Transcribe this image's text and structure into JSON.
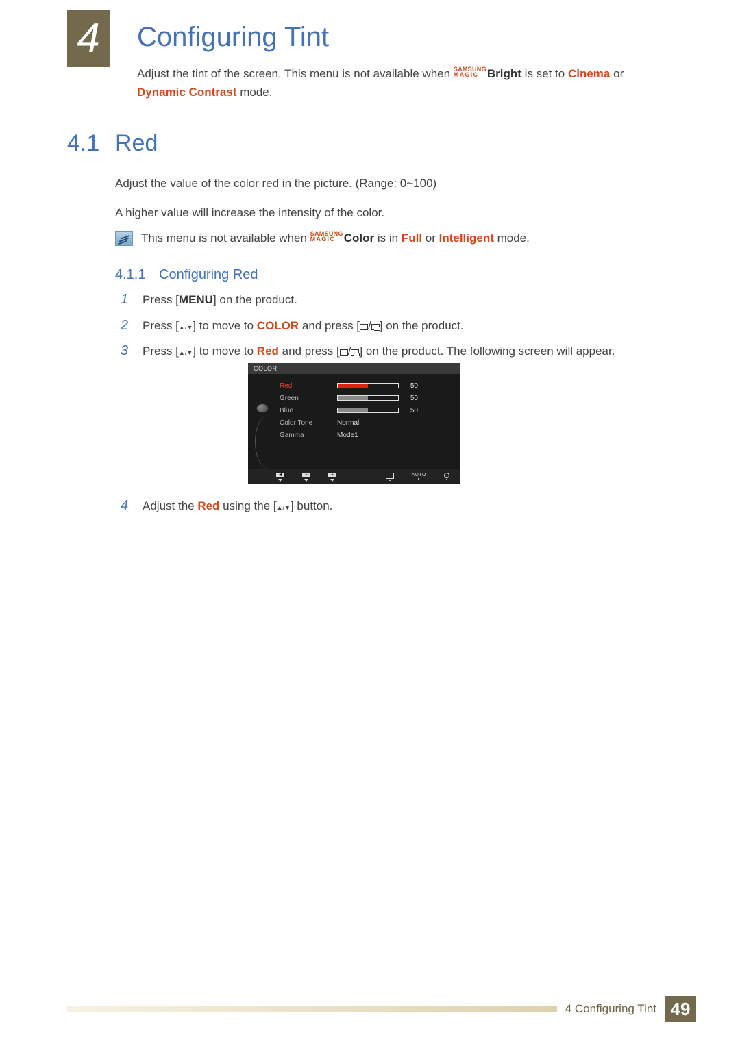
{
  "chapter": {
    "number": "4",
    "title": "Configuring Tint"
  },
  "intro": {
    "pre": "Adjust the tint of the screen. This menu is not available when ",
    "magic_top": "SAMSUNG",
    "magic_bot": "MAGIC",
    "bright_word": "Bright",
    "mid": " is set to ",
    "cinema": "Cinema",
    "or": " or ",
    "dynamic": "Dynamic Contrast",
    "tail": " mode."
  },
  "section": {
    "number": "4.1",
    "title": "Red"
  },
  "para1": "Adjust the value of the color red in the picture. (Range: 0~100)",
  "para2": "A higher value will increase the intensity of the color.",
  "note": {
    "pre": "This menu is not available when ",
    "magic_top": "SAMSUNG",
    "magic_bot": "MAGIC",
    "color_word": "Color",
    "mid": " is in ",
    "full": "Full",
    "or": " or ",
    "intelligent": "Intelligent",
    "tail": " mode."
  },
  "subsection": {
    "number": "4.1.1",
    "title": "Configuring Red"
  },
  "steps": {
    "s1_pre": "Press [",
    "s1_menu": "MENU",
    "s1_post": "] on the product.",
    "s2_pre": "Press [",
    "s2_mid": "] to move to ",
    "s2_color": "COLOR",
    "s2_and": " and press [",
    "s2_post": "] on the product.",
    "s3_pre": "Press [",
    "s3_mid": "] to move to ",
    "s3_red": "Red",
    "s3_and": " and press [",
    "s3_post": "] on the product. The following screen will appear.",
    "s4_pre": "Adjust the ",
    "s4_red": "Red",
    "s4_mid": " using the [",
    "s4_post": "] button.",
    "n1": "1",
    "n2": "2",
    "n3": "3",
    "n4": "4"
  },
  "osd": {
    "title": "COLOR",
    "rows": [
      {
        "label": "Red",
        "value": "50",
        "selected": true,
        "type": "bar",
        "fill_pct": 50,
        "color": "red"
      },
      {
        "label": "Green",
        "value": "50",
        "selected": false,
        "type": "bar",
        "fill_pct": 50,
        "color": "grey"
      },
      {
        "label": "Blue",
        "value": "50",
        "selected": false,
        "type": "bar",
        "fill_pct": 50,
        "color": "grey"
      },
      {
        "label": "Color Tone",
        "value": "Normal",
        "selected": false,
        "type": "text"
      },
      {
        "label": "Gamma",
        "value": "Mode1",
        "selected": false,
        "type": "text"
      }
    ],
    "footer_auto": "AUTO"
  },
  "footer": {
    "chapter_label": "4 Configuring Tint",
    "page": "49"
  }
}
